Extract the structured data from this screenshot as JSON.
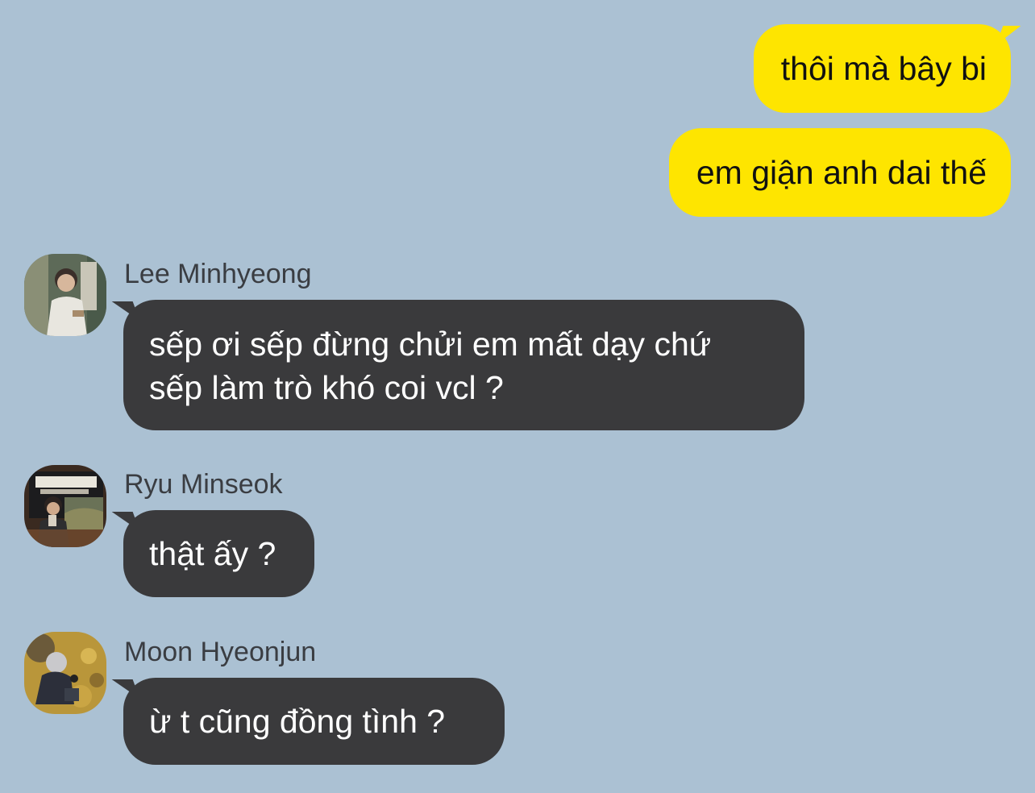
{
  "chat": {
    "outgoing": [
      {
        "text": "thôi mà bây bi"
      },
      {
        "text": "em giận anh dai thế"
      }
    ],
    "incoming": [
      {
        "sender": "Lee Minhyeong",
        "lines": [
          "sếp ơi sếp đừng chửi em mất dạy chứ",
          "sếp làm trò khó coi vcl ?"
        ]
      },
      {
        "sender": "Ryu Minseok",
        "lines": [
          "thật ấy ?"
        ]
      },
      {
        "sender": "Moon Hyeonjun",
        "lines": [
          "ừ t cũng đồng tình ?"
        ]
      }
    ]
  },
  "colors": {
    "background": "#abc1d3",
    "outgoing_bubble": "#fee500",
    "incoming_bubble": "#3a3a3c"
  }
}
